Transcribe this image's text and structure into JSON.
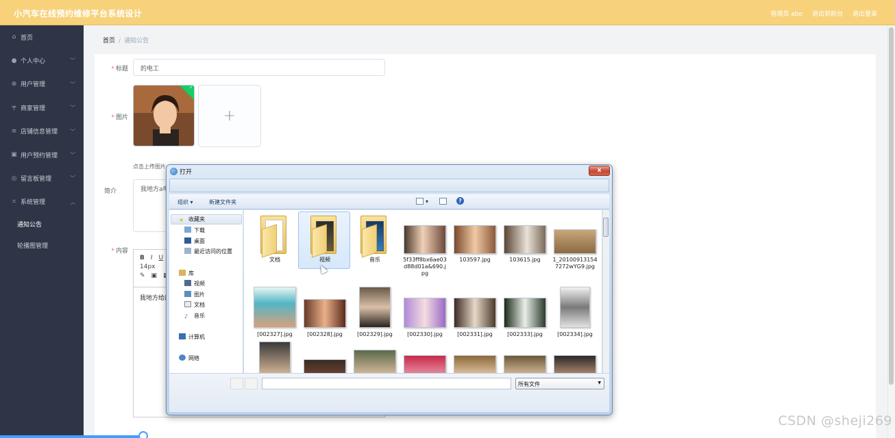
{
  "header": {
    "app_title": "小汽车在线预约维修平台系统设计",
    "user_label": "管理员 abo",
    "front_link": "退出到前台",
    "logout_link": "退出登录"
  },
  "sidebar": {
    "items": [
      {
        "label": "首页",
        "icon": "home-icon",
        "has_chevron": false
      },
      {
        "label": "个人中心",
        "icon": "user-icon",
        "has_chevron": true
      },
      {
        "label": "用户管理",
        "icon": "users-icon",
        "has_chevron": true
      },
      {
        "label": "商家管理",
        "icon": "shop-icon",
        "has_chevron": true
      },
      {
        "label": "店铺信息管理",
        "icon": "list-icon",
        "has_chevron": true
      },
      {
        "label": "用户预约管理",
        "icon": "calendar-icon",
        "has_chevron": true
      },
      {
        "label": "留言板管理",
        "icon": "message-icon",
        "has_chevron": true
      },
      {
        "label": "系统管理",
        "icon": "system-icon",
        "has_chevron": true,
        "expanded": true
      }
    ],
    "submenu": [
      "通知公告",
      "轮播图管理"
    ]
  },
  "breadcrumb": {
    "home": "首页",
    "separator": "/",
    "current": "通知公告"
  },
  "form": {
    "title_label": "标题",
    "title_value": "的电工",
    "image_label": "图片",
    "upload_tip": "点击上传图片",
    "intro_label": "简介",
    "intro_value": "我地方a电",
    "content_label": "内容",
    "font_size": "14px",
    "content_value": "我地方给的",
    "toolbar_bold": "B",
    "toolbar_italic": "I",
    "toolbar_underline": "U"
  },
  "dialog": {
    "title": "打开",
    "close": "x",
    "organize": "组织 ▾",
    "new_folder": "新建文件夹",
    "help": "?",
    "nav": {
      "favorites": "收藏夹",
      "downloads": "下载",
      "desktop": "桌面",
      "recent": "最近访问的位置",
      "library": "库",
      "videos": "视频",
      "pictures": "图片",
      "documents": "文档",
      "music": "音乐",
      "computer": "计算机",
      "network": "网络"
    },
    "files_row1": [
      {
        "name": "文档",
        "kind": "folder"
      },
      {
        "name": "视频",
        "kind": "folder-video",
        "selected": true
      },
      {
        "name": "音乐",
        "kind": "folder-music"
      },
      {
        "name": "5f33ff8bx6ae03\nd88d01a&690.j\npg",
        "kind": "photo"
      },
      {
        "name": "103597.jpg",
        "kind": "photo"
      },
      {
        "name": "103615.jpg",
        "kind": "photo"
      },
      {
        "name": "1_20100913154\n7272wYG9.jpg",
        "kind": "photo"
      }
    ],
    "files_row2": [
      {
        "name": "[002327].jpg"
      },
      {
        "name": "[002328].jpg"
      },
      {
        "name": "[002329].jpg"
      },
      {
        "name": "[002330].jpg"
      },
      {
        "name": "[002331].jpg"
      },
      {
        "name": "[002333].jpg"
      },
      {
        "name": "[002334].jpg"
      }
    ],
    "file_type_filter": "所有文件"
  },
  "watermark": "CSDN @sheji269",
  "colors": {
    "header": "#f7d27a",
    "sidebar": "#2e3546",
    "accent": "#409eff",
    "required": "#f56c6c"
  }
}
